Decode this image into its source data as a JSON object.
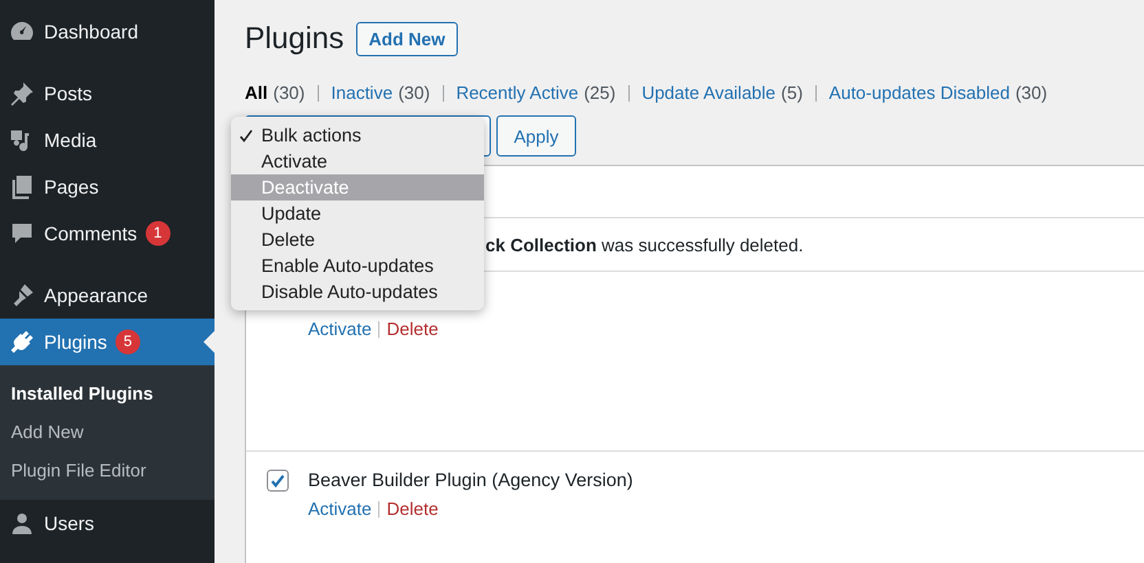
{
  "sidebar": {
    "groups": [
      [
        {
          "label": "Dashboard",
          "selected": false
        }
      ],
      [
        {
          "label": "Posts",
          "selected": false
        },
        {
          "label": "Media",
          "selected": false
        },
        {
          "label": "Pages",
          "selected": false
        },
        {
          "label": "Comments",
          "selected": false,
          "badge": "1"
        }
      ],
      [
        {
          "label": "Appearance",
          "selected": false
        },
        {
          "label": "Plugins",
          "selected": true,
          "badge": "5",
          "children": [
            {
              "label": "Installed Plugins",
              "selected": true
            },
            {
              "label": "Add New",
              "selected": false
            },
            {
              "label": "Plugin File Editor",
              "selected": false
            }
          ]
        },
        {
          "label": "Users",
          "selected": false
        }
      ]
    ]
  },
  "page": {
    "title": "Plugins",
    "add_new": "Add New"
  },
  "filters": [
    {
      "label": "All",
      "count": "(30)",
      "selected": true
    },
    {
      "label": "Inactive",
      "count": "(30)",
      "selected": false
    },
    {
      "label": "Recently Active",
      "count": "(25)",
      "selected": false
    },
    {
      "label": "Update Available",
      "count": "(5)",
      "selected": false
    },
    {
      "label": "Auto-updates Disabled",
      "count": "(30)",
      "selected": false
    }
  ],
  "bulk": {
    "apply": "Apply",
    "menu": [
      {
        "label": "Bulk actions",
        "checked": true,
        "highlighted": false
      },
      {
        "label": "Activate",
        "checked": false,
        "highlighted": false
      },
      {
        "label": "Deactivate",
        "checked": false,
        "highlighted": true
      },
      {
        "label": "Update",
        "checked": false,
        "highlighted": false
      },
      {
        "label": "Delete",
        "checked": false,
        "highlighted": false
      },
      {
        "label": "Enable Auto-updates",
        "checked": false,
        "highlighted": false
      },
      {
        "label": "Disable Auto-updates",
        "checked": false,
        "highlighted": false
      }
    ]
  },
  "table": {
    "rows": [
      {
        "kind": "blank"
      },
      {
        "kind": "notice",
        "text": "**ck Collection** was successfully deleted."
      },
      {
        "kind": "plugin",
        "actions": [
          {
            "label": "Activate",
            "kind": "activate"
          },
          {
            "label": "Delete",
            "kind": "delete"
          }
        ]
      },
      {
        "kind": "plugin",
        "name": "Beaver Builder Plugin (Agency Version)",
        "checked": true,
        "actions": [
          {
            "label": "Activate",
            "kind": "activate"
          },
          {
            "label": "Delete",
            "kind": "delete"
          }
        ]
      }
    ]
  }
}
